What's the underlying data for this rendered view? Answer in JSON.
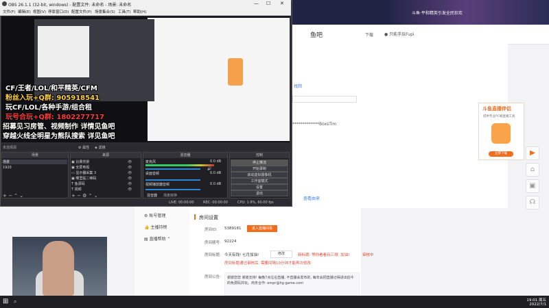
{
  "obs": {
    "title": "OBS 26.1.1 (32-bit, windows) - 配置文件: 未命名 - 场景: 未命名",
    "menu": [
      "文件(F)",
      "编辑(E)",
      "视图(V)",
      "停靠窗口(D)",
      "配置文件(P)",
      "场景集合(S)",
      "工具(T)",
      "帮助(H)"
    ],
    "overlay_lines": [
      "CF/王者/LOL/和平精英/CFM",
      "粉丝入玩+Q群: 905918541",
      "玩CF/LOL/各种手游/组合租",
      "玩号合玩+Q群: 1802277717",
      "招募见习房管、视频制作 详情见鱼吧",
      "穿越火线全明星为熊队搜索 详见鱼吧"
    ],
    "scene_bar": {
      "label": "未选择源",
      "props": "属性",
      "filters": "滤镜"
    },
    "panels": {
      "scenes": "场景",
      "sources": "来源",
      "mixer": "混音器",
      "transitions": "转场动画",
      "controls": "控制"
    },
    "scenes": [
      "场景",
      "1920"
    ],
    "sources": [
      "比赛背景",
      "全屏电视",
      "显示器采集 3",
      "哪里贴二维码",
      "鱼源码",
      "视频"
    ],
    "mixer": [
      {
        "name": "麦克风",
        "level": "0.0 dB"
      },
      {
        "name": "桌面音频",
        "level": "0.0 dB"
      },
      {
        "name": "视频播放器音频",
        "level": "0.0 dB"
      }
    ],
    "mixer_tabs": [
      "混音器",
      "场景转换"
    ],
    "controls": [
      "停止推流",
      "开始录制",
      "启动虚拟摄像机",
      "工作室模式",
      "设置",
      "退出"
    ],
    "status": {
      "live": "LIVE: 00:00:00",
      "rec": "REC: 00:00:00",
      "cpu": "CPU: 1.9%, 60.00 fps"
    }
  },
  "site": {
    "banner": "斗鱼·平和精英引发全民狂欢",
    "header_title": "鱼吧",
    "download": "下载",
    "user": "只能手玩Fupi",
    "link1": "找回",
    "stars": "*************BoxsTim",
    "link2": "查看由来",
    "nav": [
      "账号管理",
      "主播持榜",
      "直播帮助"
    ],
    "room": {
      "section_title": "房间设置",
      "room_id_label": "房间ID:",
      "room_id": "5389181",
      "enter_btn": "进入直播间看",
      "room_no_label": "房间靓号:",
      "room_no": "92224",
      "title_label": "房间标题:",
      "title": "今天有钱! 七月加油!",
      "edit": "修改",
      "hint_new": "新标题: 等你看看玩三排, 加油!",
      "status": "审核中",
      "hint_rule": "房间标题通过审核后, 需要间隔10分钟才能再次修改",
      "notice_label": "房间公告:",
      "notice": "谢谢您您 谢谢支持! 每晚7点左右直播, 不直播会发布的, 每年会把直播记得进出伯牛的免费码并玩。商务合作: empr@hg-game.com"
    },
    "promo": {
      "title": "斗鱼直播伴侣",
      "subtitle": "提供专业PC端直播工具",
      "btn": "立即下载"
    }
  },
  "taskbar": {
    "time": "19:01 周五",
    "date": "2022/7/1"
  }
}
